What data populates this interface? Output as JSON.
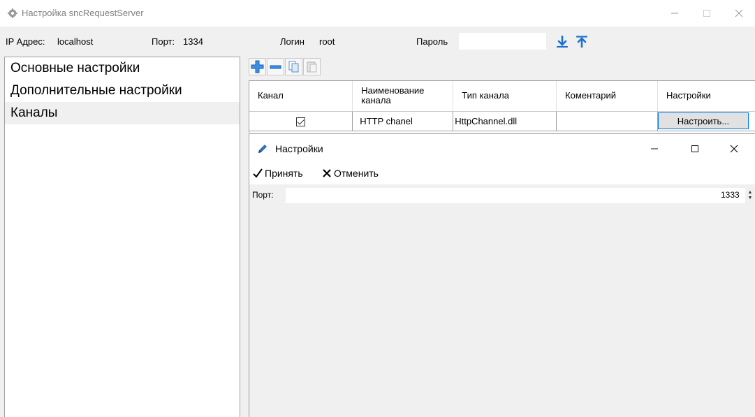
{
  "window": {
    "title": "Настройка sncRequestServer"
  },
  "connection": {
    "ip_label": "IP Адрес:",
    "ip_value": "localhost",
    "port_label": "Порт:",
    "port_value": "1334",
    "login_label": "Логин",
    "login_value": "root",
    "password_label": "Пароль",
    "password_value": ""
  },
  "sidebar": {
    "items": [
      {
        "label": "Основные настройки"
      },
      {
        "label": "Дополнительные настройки"
      },
      {
        "label": "Каналы"
      }
    ],
    "selected_index": 2
  },
  "toolbar": {
    "icons": [
      "add-icon",
      "remove-icon",
      "copy-icon",
      "paste-icon"
    ]
  },
  "grid": {
    "columns": [
      "Канал",
      "Наименование канала",
      "Тип канала",
      "Коментарий",
      "Настройки"
    ],
    "rows": [
      {
        "checked": true,
        "name": "HTTP chanel",
        "type": "HttpChannel.dll",
        "comment": "",
        "settings_label": "Настроить..."
      }
    ]
  },
  "settings_window": {
    "title": "Настройки",
    "accept_label": "Принять",
    "cancel_label": "Отменить",
    "port_label": "Порт:",
    "port_value": "1333"
  },
  "colors": {
    "accent": "#0078d7",
    "arrow_blue": "#1d6fd1"
  }
}
